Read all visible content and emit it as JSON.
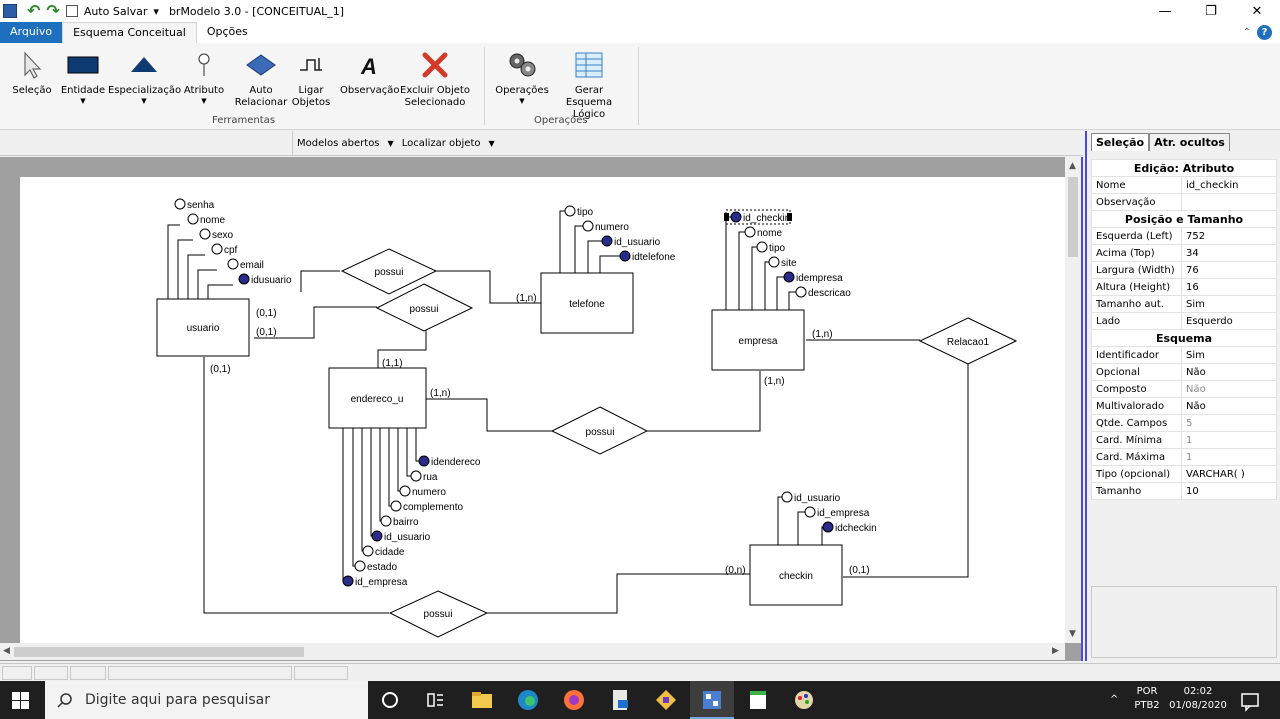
{
  "titlebar": {
    "autosave_label": "Auto Salvar",
    "title": "brModelo 3.0 - [CONCEITUAL_1]",
    "minimize": "—",
    "restore": "❐",
    "close": "✕"
  },
  "tabs": {
    "file": "Arquivo",
    "conceptual": "Esquema Conceitual",
    "options": "Opções"
  },
  "ribbon": {
    "selecao": "Seleção",
    "entidade": "Entidade",
    "especializacao": "Especialização",
    "atributo": "Atributo",
    "auto_relacionar_1": "Auto",
    "auto_relacionar_2": "Relacionar",
    "ligar_1": "Ligar",
    "ligar_2": "Objetos",
    "observacao": "Observação",
    "excluir_1": "Excluir Objeto",
    "excluir_2": "Selecionado",
    "operacoes": "Operações",
    "gerar_1": "Gerar Esquema",
    "gerar_2": "Lógico",
    "group_ferramentas": "Ferramentas",
    "group_operacoes": "Operações"
  },
  "toolbar": {
    "modelos": "Modelos abertos",
    "localizar": "Localizar objeto"
  },
  "diagram": {
    "entities": {
      "usuario": "usuario",
      "telefone": "telefone",
      "empresa": "empresa",
      "endereco": "endereco_u",
      "checkin": "checkin"
    },
    "relations": {
      "possui1": "possui",
      "possui2": "possui",
      "possui3": "possui",
      "possui4": "possui",
      "relacao1": "Relacao1"
    },
    "usuario_attrs": [
      "senha",
      "nome",
      "sexo",
      "cpf",
      "email",
      "idusuario"
    ],
    "telefone_attrs": [
      "tipo",
      "numero",
      "id_usuario",
      "idtelefone"
    ],
    "empresa_attrs": [
      "id_checkin",
      "nome",
      "tipo",
      "site",
      "idempresa",
      "descricao"
    ],
    "endereco_attrs": [
      "idendereco",
      "rua",
      "numero",
      "complemento",
      "bairro",
      "id_usuario",
      "cidade",
      "estado",
      "id_empresa"
    ],
    "checkin_attrs": [
      "id_usuario",
      "id_empresa",
      "idcheckin"
    ],
    "cardinalities": {
      "usu_possui1": "(0,1)",
      "usu_possui2": "(0,1)",
      "usu_possui4": "(0,1)",
      "tel_possui1": "(1,n)",
      "end_possui2": "(1,1)",
      "end_possui3": "(1,n)",
      "emp_possui3": "(1,n)",
      "emp_rel1": "(1,n)",
      "chk_possui4": "(0,n)",
      "chk_rel1": "(0,1)"
    }
  },
  "panel": {
    "tab_selecao": "Seleção",
    "tab_ocultos": "Atr. ocultos",
    "section_edicao": "Edição: Atributo",
    "section_posicao": "Posição e Tamanho",
    "section_esquema": "Esquema",
    "rows_edicao": [
      {
        "k": "Nome",
        "v": "id_checkin"
      },
      {
        "k": "Observação",
        "v": ""
      }
    ],
    "rows_posicao": [
      {
        "k": "Esquerda (Left)",
        "v": "752"
      },
      {
        "k": "Acima (Top)",
        "v": "34"
      },
      {
        "k": "Largura (Width)",
        "v": "76"
      },
      {
        "k": "Altura (Height)",
        "v": "16"
      },
      {
        "k": "Tamanho aut.",
        "v": "Sim"
      },
      {
        "k": "Lado",
        "v": "Esquerdo"
      }
    ],
    "rows_esquema": [
      {
        "k": "Identificador",
        "v": "Sim"
      },
      {
        "k": "Opcional",
        "v": "Não"
      },
      {
        "k": "Composto",
        "v": "Não"
      },
      {
        "k": "Multivalorado",
        "v": "Não"
      },
      {
        "k": "Qtde. Campos",
        "v": "5"
      },
      {
        "k": "Card. Mínima",
        "v": "1"
      },
      {
        "k": "Card. Máxima",
        "v": "1"
      },
      {
        "k": "Tipo (opcional)",
        "v": "VARCHAR( )"
      },
      {
        "k": "Tamanho",
        "v": "10"
      }
    ]
  },
  "taskbar": {
    "search_placeholder": "Digite aqui para pesquisar",
    "lang1": "POR",
    "lang2": "PTB2",
    "time": "02:02",
    "date": "01/08/2020"
  }
}
